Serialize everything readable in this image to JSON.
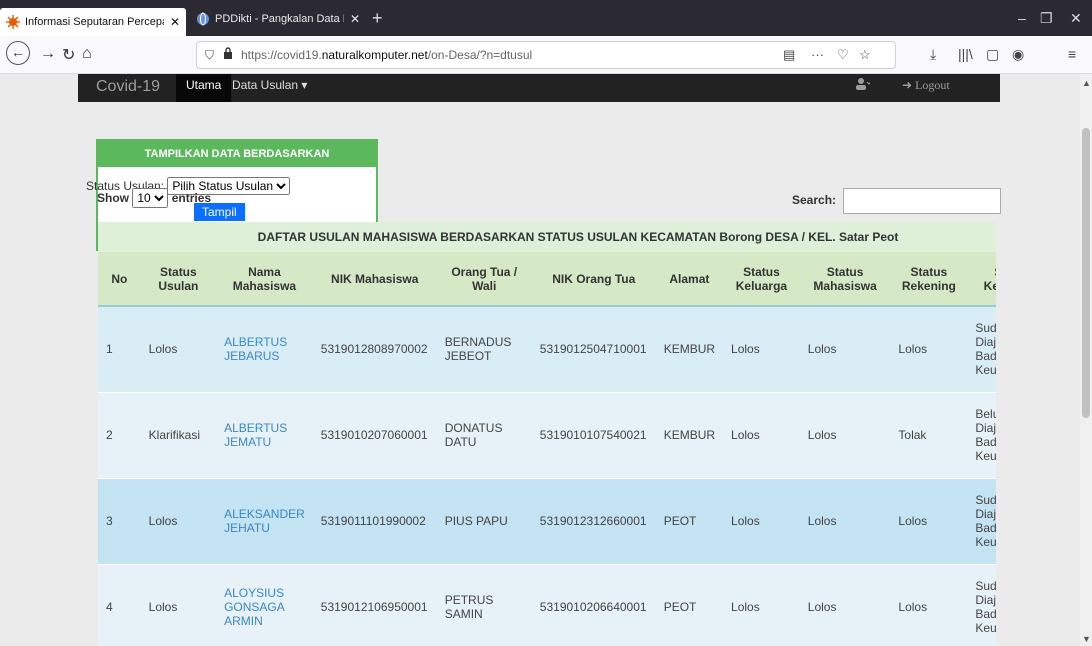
{
  "browser": {
    "tabs": [
      {
        "label": "Informasi Seputaran Percepatan",
        "active": true
      },
      {
        "label": "PDDikti - Pangkalan Data Pend",
        "active": false
      }
    ],
    "url_prefix": "https://covid19.",
    "url_domain": "naturalkomputer.net",
    "url_path": "/on-Desa/?n=dtusul"
  },
  "app": {
    "brand": "Covid-19",
    "menu": [
      {
        "label": "Utama",
        "active": true
      },
      {
        "label": "Data Usulan ▾",
        "active": false
      }
    ],
    "logout": "Logout"
  },
  "filter": {
    "title": "TAMPILKAN DATA BERDASARKAN",
    "status_label": "Status Usulan:",
    "status_selected": "Pilih Status Usulan",
    "button": "Tampil"
  },
  "table_controls": {
    "show_label": "Show",
    "entries_value": "10",
    "entries_label": "entries",
    "search_label": "Search:"
  },
  "table": {
    "caption": "DAFTAR USULAN MAHASISWA BERDASARKAN STATUS USULAN KECAMATAN Borong DESA / KEL. Satar Peot",
    "headers": [
      "No",
      "Status Usulan",
      "Nama Mahasiswa",
      "NIK Mahasiswa",
      "Orang Tua / Wali",
      "NIK Orang Tua",
      "Alamat",
      "Status Keluarga",
      "Status Mahasiswa",
      "Status Rekening",
      "Status Keuangan"
    ],
    "rows": [
      {
        "no": "1",
        "status": "Lolos",
        "nama": "ALBERTUS JEBARUS",
        "nik": "5319012808970002",
        "ortu": "BERNADUS JEBEOT",
        "nik_ortu": "5319012504710001",
        "alamat": "KEMBUR",
        "keluarga": "Lolos",
        "mahasiswa": "Lolos",
        "rekening": "Lolos",
        "keuangan": "Sudah Diajukan Badan Keuangan"
      },
      {
        "no": "2",
        "status": "Klarifikasi",
        "nama": "ALBERTUS JEMATU",
        "nik": "5319010207060001",
        "ortu": "DONATUS DATU",
        "nik_ortu": "5319010107540021",
        "alamat": "KEMBUR",
        "keluarga": "Lolos",
        "mahasiswa": "Lolos",
        "rekening": "Tolak",
        "keuangan": "Belum Diajukan Badan Keuangan"
      },
      {
        "no": "3",
        "status": "Lolos",
        "nama": "ALEKSANDER JEHATU",
        "nik": "5319011101990002",
        "ortu": "PIUS PAPU",
        "nik_ortu": "5319012312660001",
        "alamat": "PEOT",
        "keluarga": "Lolos",
        "mahasiswa": "Lolos",
        "rekening": "Lolos",
        "keuangan": "Sudah Diajukan Badan Keuangan"
      },
      {
        "no": "4",
        "status": "Lolos",
        "nama": "ALOYSIUS GONSAGA ARMIN",
        "nik": "5319012106950001",
        "ortu": "PETRUS SAMIN",
        "nik_ortu": "5319010206640001",
        "alamat": "PEOT",
        "keluarga": "Lolos",
        "mahasiswa": "Lolos",
        "rekening": "Lolos",
        "keuangan": "Sudah Diajukan Badan Keuangan"
      }
    ]
  }
}
